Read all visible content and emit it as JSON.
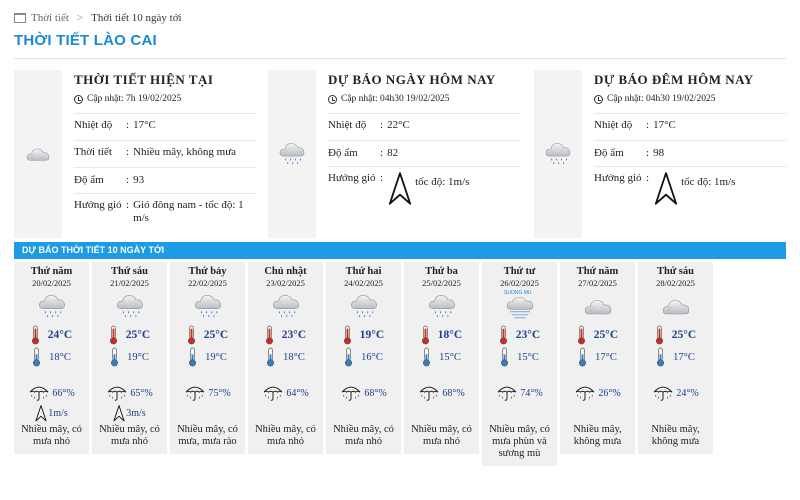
{
  "breadcrumb": {
    "home": "Thời tiết",
    "separator": ">",
    "current": "Thời tiết 10 ngày tới"
  },
  "page_title": "THỜI TIẾT LÀO CAI",
  "current": {
    "title": "THỜI TIẾT HIỆN TẠI",
    "updated": "Cập nhật: 7h 19/02/2025",
    "icon": "cloud-icon",
    "rows": [
      {
        "label": "Nhiệt độ",
        "value": "17°C"
      },
      {
        "label": "Thời tiết",
        "value": "Nhiều mây, không mưa"
      },
      {
        "label": "Độ ẩm",
        "value": "93"
      },
      {
        "label": "Hướng gió",
        "value": "Gió đông nam - tốc độ: 1 m/s"
      }
    ]
  },
  "today": {
    "title": "DỰ BÁO NGÀY HÔM NAY",
    "updated": "Cập nhật: 04h30 19/02/2025",
    "icon": "rain-cloud-icon",
    "temp_label": "Nhiệt độ",
    "temp": "22°C",
    "humidity_label": "Độ ẩm",
    "humidity": "82",
    "wind_label": "Hướng gió",
    "wind": "tốc độ: 1m/s"
  },
  "tonight": {
    "title": "DỰ BÁO ĐÊM HÔM NAY",
    "updated": "Cập nhật: 04h30 19/02/2025",
    "icon": "rain-cloud-icon",
    "temp_label": "Nhiệt độ",
    "temp": "17°C",
    "humidity_label": "Độ ẩm",
    "humidity": "98",
    "wind_label": "Hướng gió",
    "wind": "tốc độ: 1m/s"
  },
  "ten_day_title": "DỰ BÁO THỜI TIẾT 10 NGÀY TỚI",
  "days": [
    {
      "name": "Thứ năm",
      "date": "20/02/2025",
      "icon": "rain-cloud-icon",
      "max": "24°C",
      "min": "18°C",
      "rain": "66°%",
      "wind": "1m/s",
      "desc": "Nhiều mây, có mưa nhỏ"
    },
    {
      "name": "Thứ sáu",
      "date": "21/02/2025",
      "icon": "rain-cloud-icon",
      "max": "25°C",
      "min": "19°C",
      "rain": "65°%",
      "wind": "3m/s",
      "desc": "Nhiều mây, có mưa nhỏ"
    },
    {
      "name": "Thứ bảy",
      "date": "22/02/2025",
      "icon": "rain-cloud-icon",
      "max": "25°C",
      "min": "19°C",
      "rain": "75°%",
      "wind": "",
      "desc": "Nhiều mây, có mưa, mưa rào"
    },
    {
      "name": "Chủ nhật",
      "date": "23/02/2025",
      "icon": "rain-cloud-icon",
      "max": "23°C",
      "min": "18°C",
      "rain": "64°%",
      "wind": "",
      "desc": "Nhiều mây, có mưa nhỏ"
    },
    {
      "name": "Thứ hai",
      "date": "24/02/2025",
      "icon": "rain-cloud-icon",
      "max": "19°C",
      "min": "16°C",
      "rain": "68°%",
      "wind": "",
      "desc": "Nhiều mây, có mưa nhỏ"
    },
    {
      "name": "Thứ ba",
      "date": "25/02/2025",
      "icon": "rain-cloud-icon",
      "max": "18°C",
      "min": "15°C",
      "rain": "68°%",
      "wind": "",
      "desc": "Nhiều mây, có mưa nhỏ"
    },
    {
      "name": "Thứ tư",
      "date": "26/02/2025",
      "icon": "fog-cloud-icon",
      "fog_label": "SUONG MU",
      "max": "23°C",
      "min": "15°C",
      "rain": "74°%",
      "wind": "",
      "desc": "Nhiều mây, có mưa phùn và sương mù"
    },
    {
      "name": "Thứ năm",
      "date": "27/02/2025",
      "icon": "cloud-icon",
      "max": "25°C",
      "min": "17°C",
      "rain": "26°%",
      "wind": "",
      "desc": "Nhiều mây, không mưa"
    },
    {
      "name": "Thứ sáu",
      "date": "28/02/2025",
      "icon": "cloud-icon",
      "max": "25°C",
      "min": "17°C",
      "rain": "24°%",
      "wind": "",
      "desc": "Nhiều mây, không mưa"
    }
  ],
  "colors": {
    "accent": "#1d9be4",
    "title": "#1a8ad6",
    "temp_text": "#1b3f8f",
    "thermo_max": "#d9241c",
    "thermo_min": "#2f7fd1"
  }
}
